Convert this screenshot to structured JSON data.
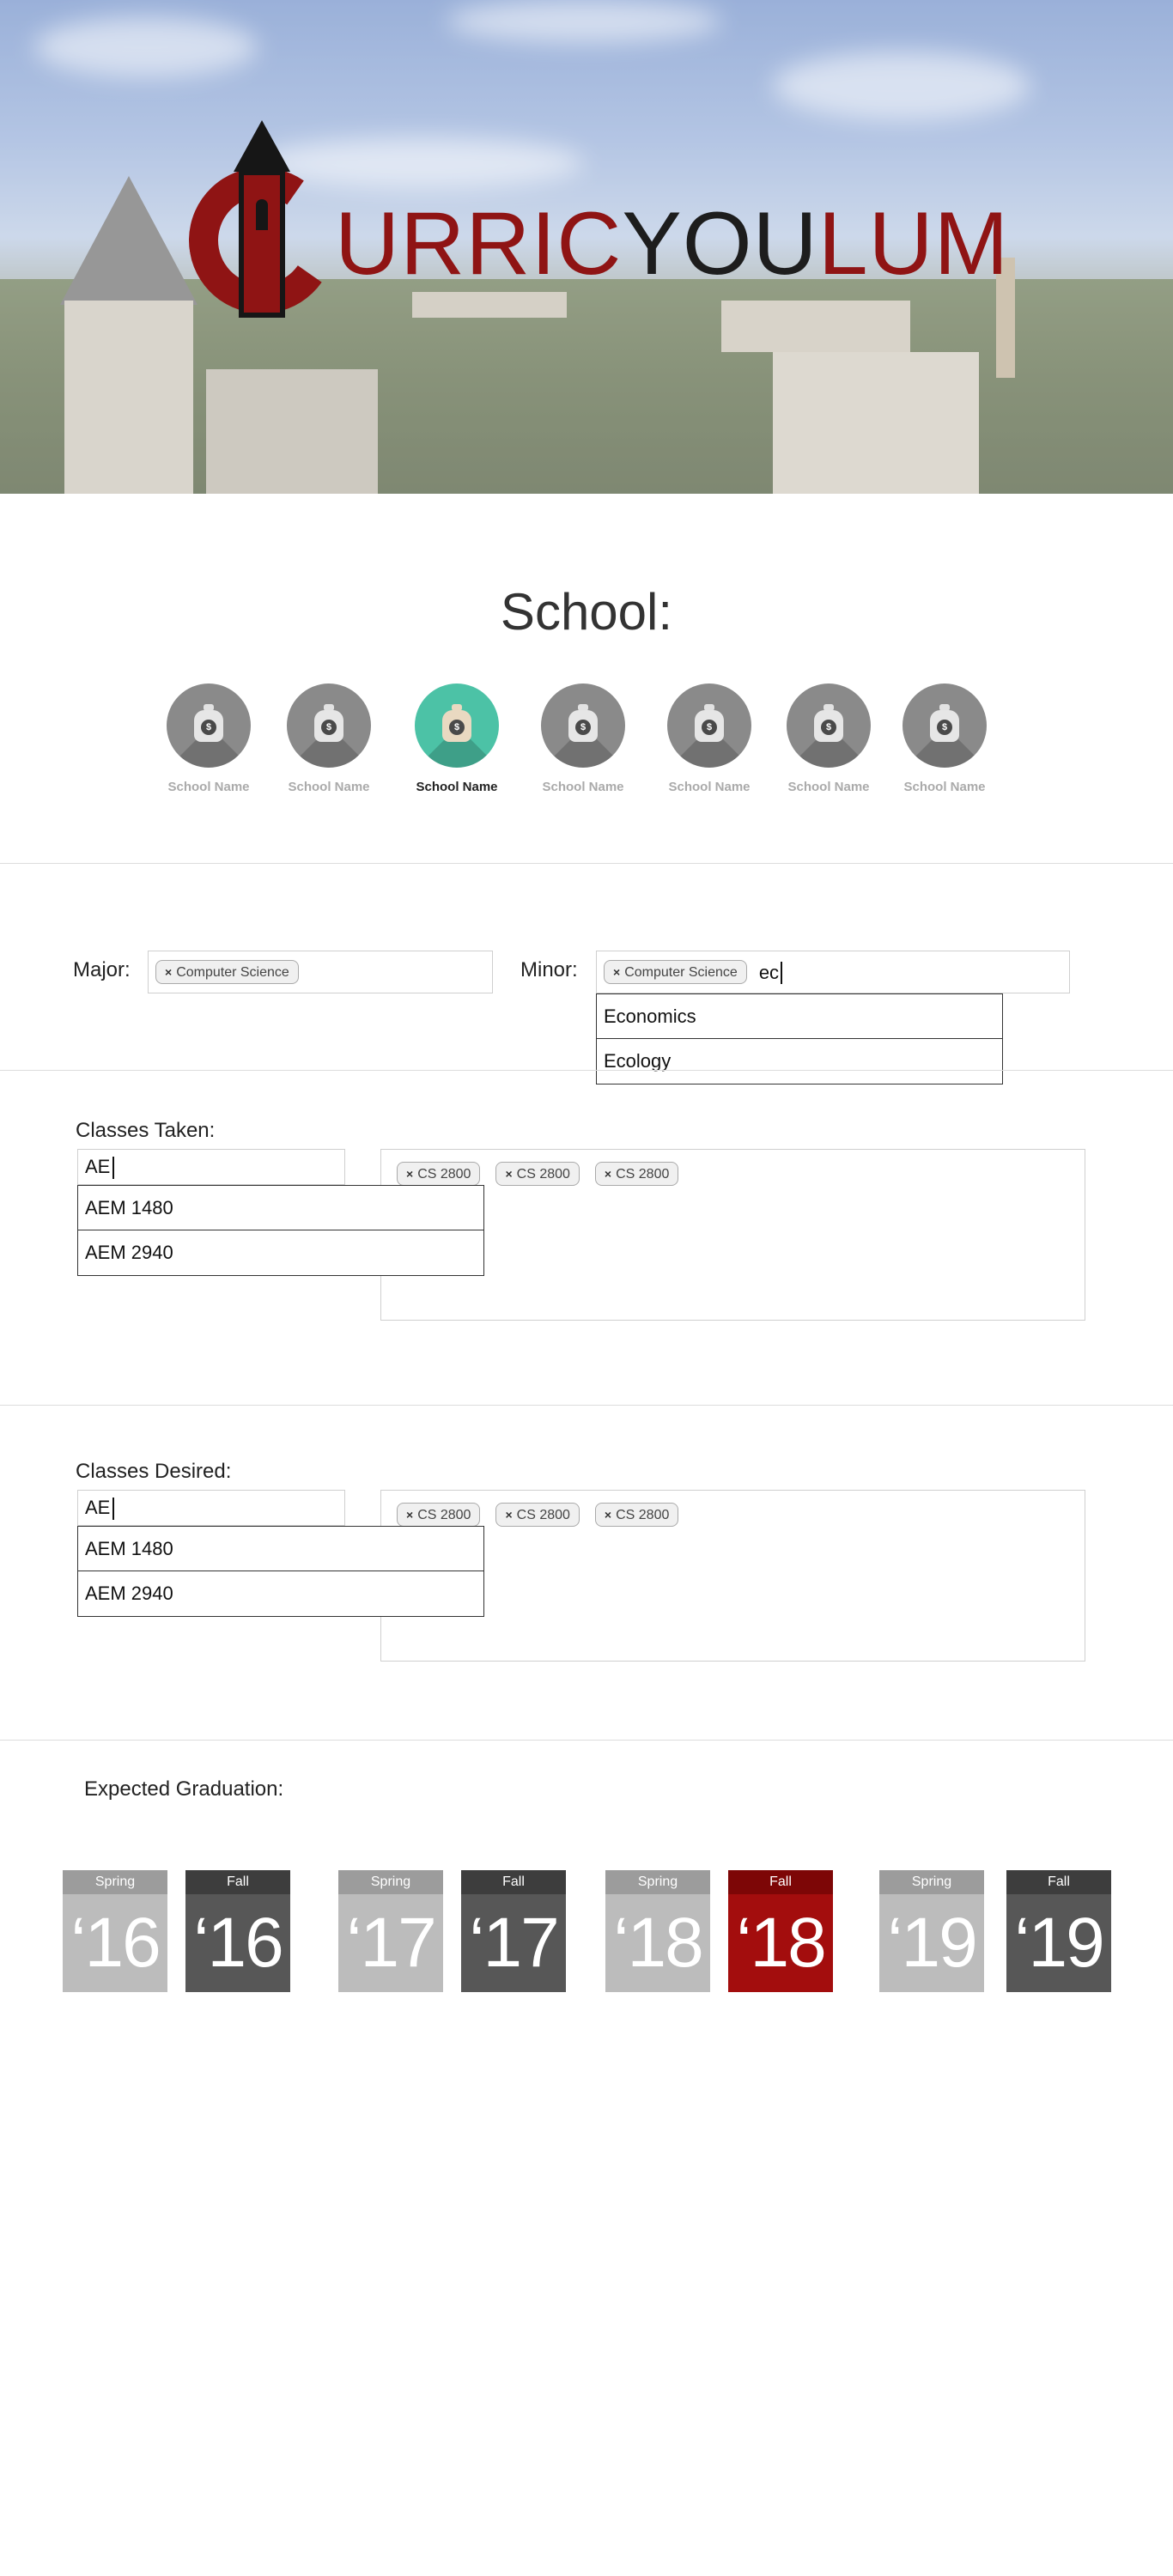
{
  "header": {
    "logo_text_1": "URRIC",
    "logo_text_2": "YOU",
    "logo_text_3": "LUM"
  },
  "school_section": {
    "title": "School:",
    "schools": [
      {
        "label": "School Name",
        "selected": false
      },
      {
        "label": "School Name",
        "selected": false
      },
      {
        "label": "School Name",
        "selected": true
      },
      {
        "label": "School Name",
        "selected": false
      },
      {
        "label": "School Name",
        "selected": false
      },
      {
        "label": "School Name",
        "selected": false
      },
      {
        "label": "School Name",
        "selected": false
      }
    ],
    "icon": "money-bag-icon",
    "coin_symbol": "$",
    "selected_color": "#4cc2a6"
  },
  "major": {
    "label": "Major:",
    "tags": [
      "Computer Science"
    ]
  },
  "minor": {
    "label": "Minor:",
    "tags": [
      "Computer Science"
    ],
    "typed_value": "ec",
    "suggestions": [
      "Economics",
      "Ecology"
    ]
  },
  "classes_taken": {
    "label": "Classes Taken:",
    "input_value": "AE",
    "suggestions": [
      "AEM 1480",
      "AEM 2940"
    ],
    "tags": [
      "CS 2800",
      "CS 2800",
      "CS 2800"
    ]
  },
  "classes_desired": {
    "label": "Classes Desired:",
    "input_value": "AE",
    "suggestions": [
      "AEM 1480",
      "AEM 2940"
    ],
    "tags": [
      "CS 2800",
      "CS 2800",
      "CS 2800"
    ]
  },
  "graduation": {
    "label": "Expected Graduation:",
    "options": [
      {
        "season": "Spring",
        "year": "‘16",
        "selected": false
      },
      {
        "season": "Fall",
        "year": "‘16",
        "selected": false
      },
      {
        "season": "Spring",
        "year": "‘17",
        "selected": false
      },
      {
        "season": "Fall",
        "year": "‘17",
        "selected": false
      },
      {
        "season": "Spring",
        "year": "‘18",
        "selected": false
      },
      {
        "season": "Fall",
        "year": "‘18",
        "selected": true
      },
      {
        "season": "Spring",
        "year": "‘19",
        "selected": false
      },
      {
        "season": "Fall",
        "year": "‘19",
        "selected": false
      }
    ],
    "selected_color": "#a30d0d"
  },
  "colors": {
    "brand_red": "#8f1414",
    "dark": "#1d1d1d"
  }
}
